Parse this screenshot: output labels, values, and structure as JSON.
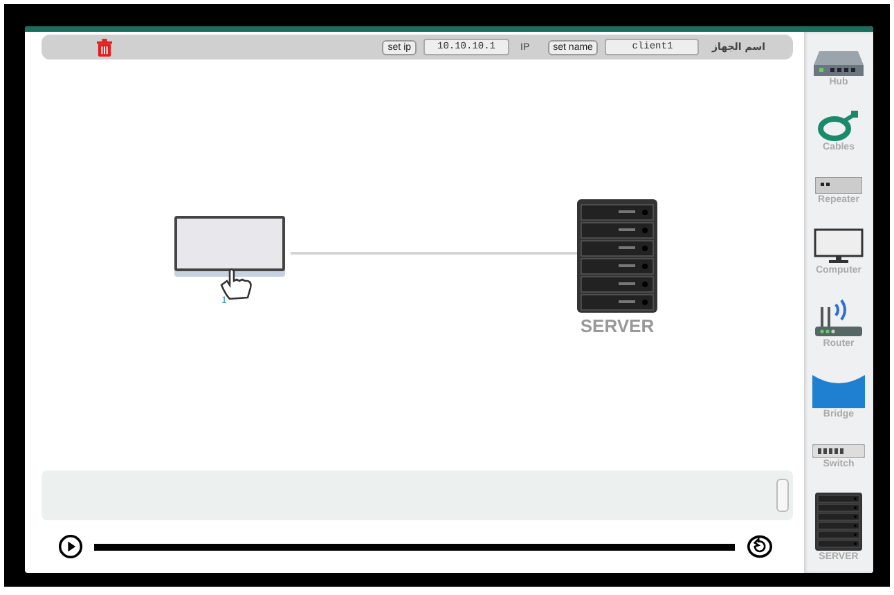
{
  "toolbar": {
    "set_ip_button": "set ip",
    "ip_value": "10.10.10.1",
    "ip_label": "IP",
    "set_name_button": "set name",
    "name_value": "client1",
    "name_label": "اسم الجهاز"
  },
  "canvas": {
    "nodes": [
      {
        "kind": "computer",
        "label": "1"
      },
      {
        "kind": "server",
        "label": "SERVER"
      }
    ]
  },
  "palette": [
    {
      "kind": "hub",
      "label": "Hub"
    },
    {
      "kind": "cables",
      "label": "Cables"
    },
    {
      "kind": "repeater",
      "label": "Repeater"
    },
    {
      "kind": "computer",
      "label": "Computer"
    },
    {
      "kind": "router",
      "label": "Router"
    },
    {
      "kind": "bridge",
      "label": "Bridge"
    },
    {
      "kind": "switch",
      "label": "Switch"
    },
    {
      "kind": "server",
      "label": "SERVER"
    }
  ]
}
